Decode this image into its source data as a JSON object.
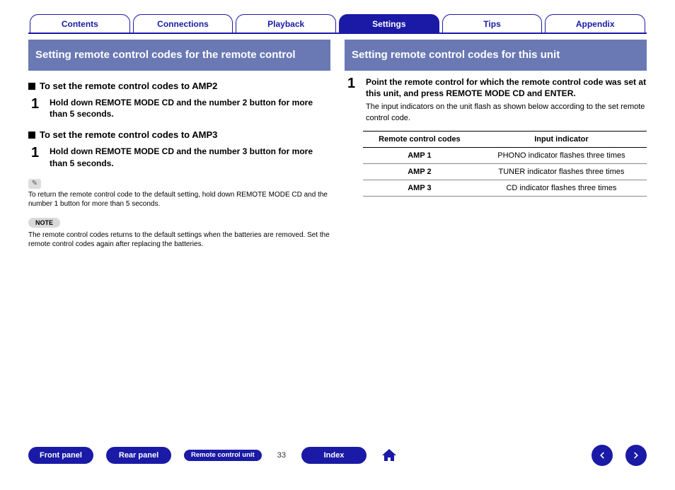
{
  "nav": {
    "tabs": [
      {
        "label": "Contents"
      },
      {
        "label": "Connections"
      },
      {
        "label": "Playback"
      },
      {
        "label": "Settings",
        "active": true
      },
      {
        "label": "Tips"
      },
      {
        "label": "Appendix"
      }
    ]
  },
  "left": {
    "heading": "Setting remote control codes for the remote control",
    "sub1": "To set the remote control codes to AMP2",
    "step1_num": "1",
    "step1_body": "Hold down REMOTE MODE CD and the number 2 button for more than 5 seconds.",
    "sub2": "To set the remote control codes to AMP3",
    "step2_num": "1",
    "step2_body": "Hold down REMOTE MODE CD and the number 3 button for more than 5 seconds.",
    "pencil_note": "To return the remote control code to the default setting, hold down REMOTE MODE CD and the number 1 button for more than 5 seconds.",
    "note_label": "NOTE",
    "note_text": "The remote control codes returns to the default settings when the batteries are removed. Set the remote control codes again after replacing the batteries."
  },
  "right": {
    "heading": "Setting remote control codes for this unit",
    "step1_num": "1",
    "step1_bold": "Point the remote control for which the remote control code was set at this unit, and press REMOTE MODE CD and ENTER.",
    "step1_plain": "The input indicators on the unit flash as shown below according to the set remote control code.",
    "table": {
      "headers": [
        "Remote control codes",
        "Input indicator"
      ],
      "rows": [
        {
          "code": "AMP 1",
          "ind": "PHONO indicator flashes three times"
        },
        {
          "code": "AMP 2",
          "ind": "TUNER indicator flashes three times"
        },
        {
          "code": "AMP 3",
          "ind": "CD indicator flashes three times"
        }
      ]
    }
  },
  "footer": {
    "buttons": {
      "front": "Front panel",
      "rear": "Rear panel",
      "remote": "Remote control unit",
      "index": "Index"
    },
    "page": "33"
  }
}
